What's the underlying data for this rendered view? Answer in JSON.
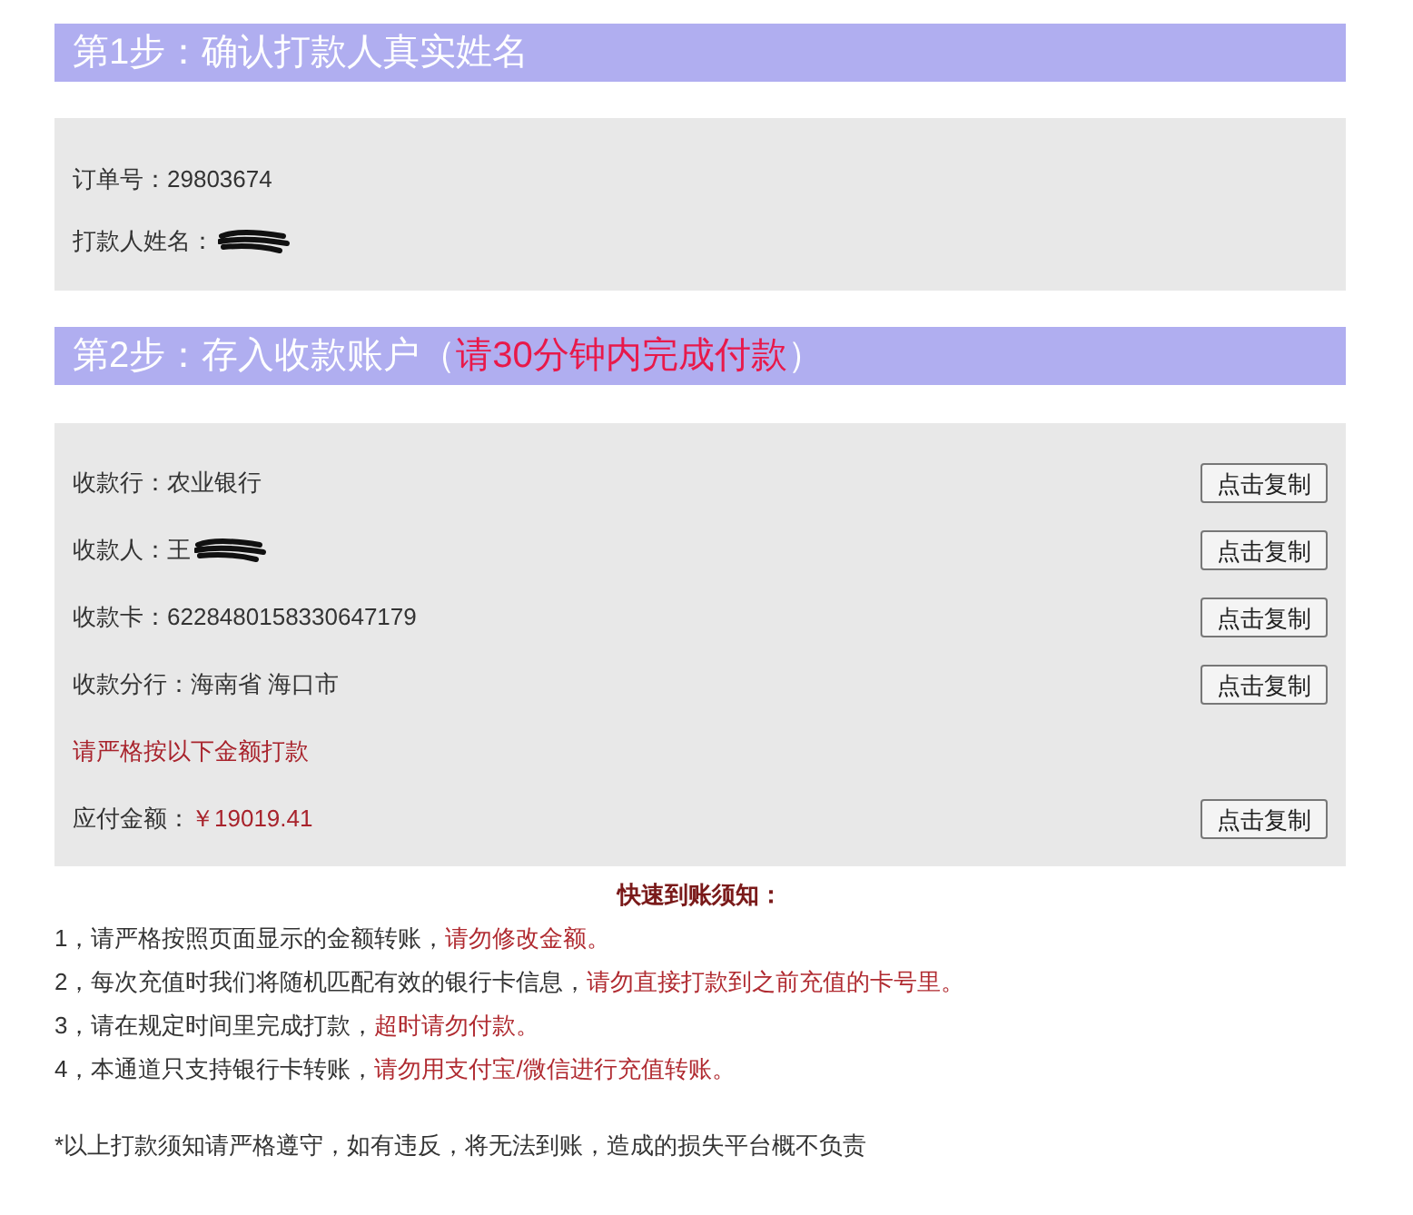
{
  "step1": {
    "title": "第1步：确认打款人真实姓名",
    "rows": [
      {
        "label": "订单号：",
        "value": "29803674",
        "redacted": false
      },
      {
        "label": "打款人姓名：",
        "value": "",
        "redacted": true
      }
    ]
  },
  "step2": {
    "title": "第2步：存入收款账户（",
    "title_highlight": "请30分钟内完成付款",
    "title_end": "）",
    "rows": [
      {
        "kind": "field",
        "label": "收款行：",
        "value": "农业银行",
        "redacted": false,
        "button": "点击复制"
      },
      {
        "kind": "field",
        "label": "收款人：",
        "value": "王",
        "redacted": true,
        "button": "点击复制"
      },
      {
        "kind": "field",
        "label": "收款卡：",
        "value": "6228480158330647179",
        "redacted": false,
        "button": "点击复制"
      },
      {
        "kind": "field",
        "label": "收款分行：",
        "value": "海南省 海口市",
        "redacted": false,
        "button": "点击复制"
      },
      {
        "kind": "warning",
        "label": "请严格按以下金额打款"
      },
      {
        "kind": "amount",
        "label": "应付金额：",
        "value": "￥19019.41",
        "redacted": false,
        "button": "点击复制"
      }
    ]
  },
  "notice": {
    "title": "快速到账须知：",
    "items": [
      {
        "text": "1，请严格按照页面显示的金额转账，",
        "warning": "请勿修改金额。"
      },
      {
        "text": "2，每次充值时我们将随机匹配有效的银行卡信息，",
        "warning": "请勿直接打款到之前充值的卡号里。"
      },
      {
        "text": "3，请在规定时间里完成打款，",
        "warning": "超时请勿付款。"
      },
      {
        "text": "4，本通道只支持银行卡转账，",
        "warning": "请勿用支付宝/微信进行充值转账。"
      }
    ],
    "footnote": "*以上打款须知请严格遵守，如有违反，将无法到账，造成的损失平台概不负责"
  }
}
